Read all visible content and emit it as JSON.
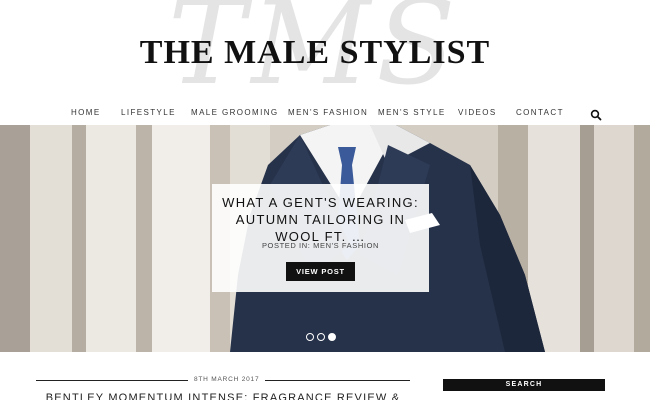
{
  "header": {
    "watermark": "TMS",
    "site_title": "THE MALE STYLIST"
  },
  "nav": {
    "items": [
      {
        "label": "HOME"
      },
      {
        "label": "LIFESTYLE"
      },
      {
        "label": "MALE GROOMING"
      },
      {
        "label": "MEN'S FASHION"
      },
      {
        "label": "MEN'S STYLE"
      },
      {
        "label": "VIDEOS"
      },
      {
        "label": "CONTACT"
      }
    ],
    "search_icon": "search-icon"
  },
  "hero": {
    "title": "WHAT A GENT'S WEARING: AUTUMN TAILORING IN WOOL FT. …",
    "meta": "POSTED IN: MEN'S FASHION",
    "button_label": "VIEW POST",
    "slides_total": 3,
    "active_slide": 1
  },
  "content": {
    "post_date": "8TH MARCH 2017",
    "post_title": "BENTLEY MOMENTUM INTENSE: FRAGRANCE REVIEW &"
  },
  "sidebar": {
    "widget_title": "SEARCH"
  },
  "colors": {
    "accent": "#111111",
    "suit": "#26324a",
    "columns": "#cfc9c0"
  }
}
